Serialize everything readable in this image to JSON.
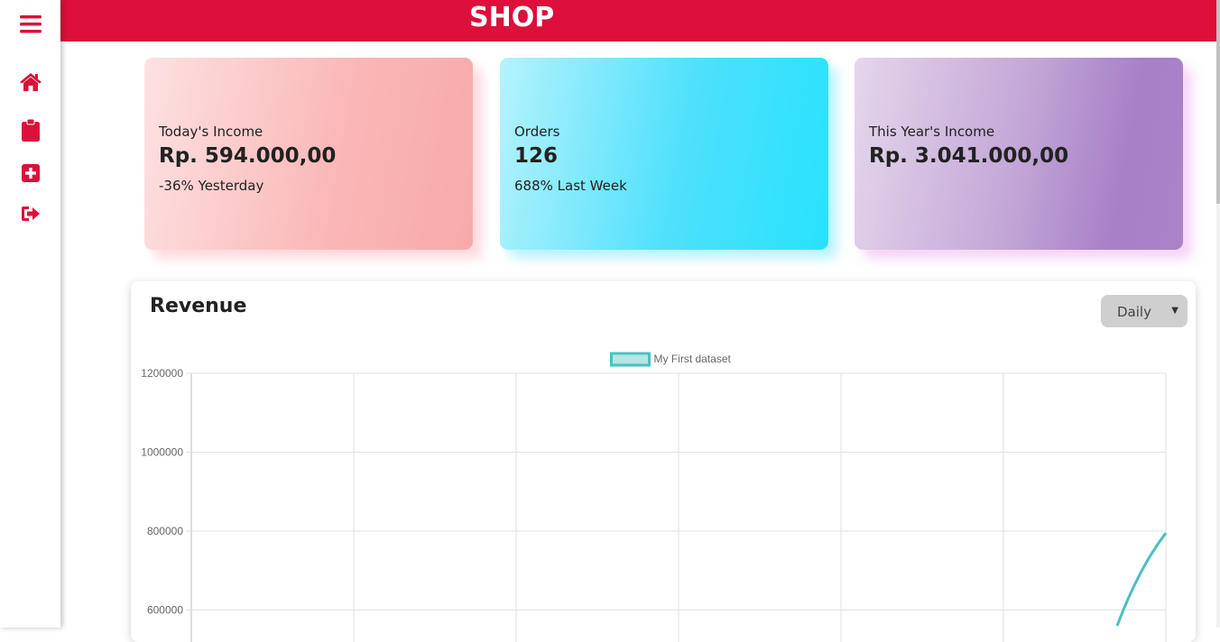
{
  "app": {
    "title": "SHOP"
  },
  "sidebar": {
    "items": [
      {
        "icon": "hamburger-menu-icon"
      },
      {
        "icon": "home-icon"
      },
      {
        "icon": "clipboard-icon"
      },
      {
        "icon": "plus-square-icon"
      },
      {
        "icon": "sign-out-icon"
      }
    ],
    "accent_color": "#dc1039"
  },
  "cards": [
    {
      "label": "Today's Income",
      "value": "Rp. 594.000,00",
      "sub": "-36% Yesterday"
    },
    {
      "label": "Orders",
      "value": "126",
      "sub": "688% Last Week"
    },
    {
      "label": "This Year's Income",
      "value": "Rp. 3.041.000,00",
      "sub": ""
    }
  ],
  "revenue": {
    "title": "Revenue",
    "period_selected": "Daily"
  },
  "chart_data": {
    "type": "line",
    "title": "",
    "xlabel": "",
    "ylabel": "",
    "y_ticks": [
      "1200000",
      "1000000",
      "800000",
      "600000"
    ],
    "ylim": [
      600000,
      1200000
    ],
    "grid": true,
    "legend": "top-center",
    "series": [
      {
        "name": "My First dataset",
        "color": "#4bc0c0",
        "points": [
          {
            "x": 5.7,
            "y": 560000
          },
          {
            "x": 6,
            "y": 795000
          }
        ]
      }
    ],
    "x_range": [
      0,
      6
    ]
  }
}
